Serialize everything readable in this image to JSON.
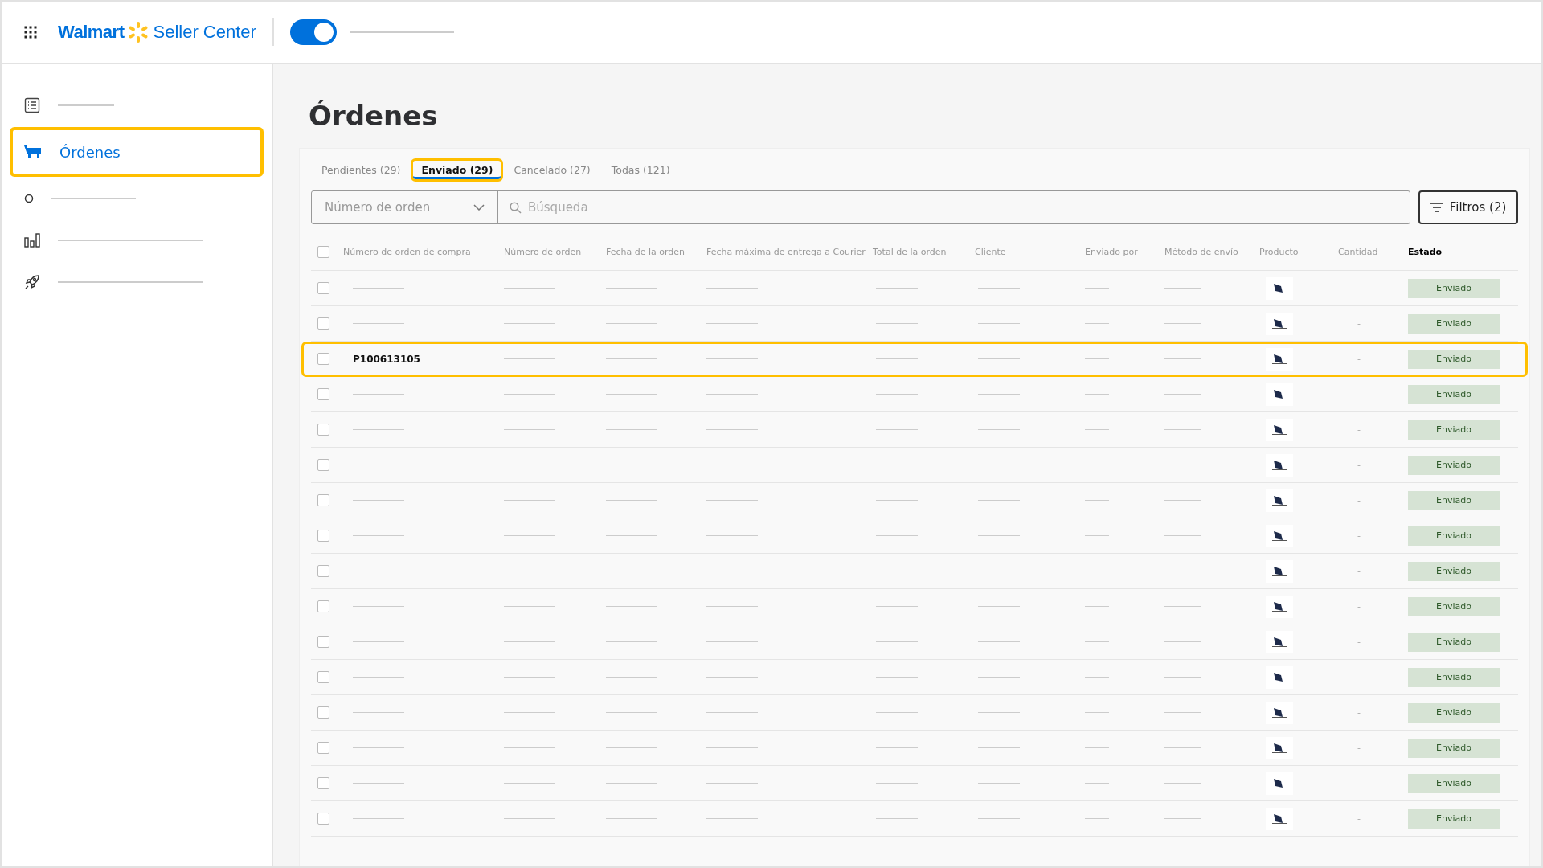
{
  "header": {
    "brand": "Walmart",
    "product": "Seller Center",
    "toggle": {
      "on": true
    }
  },
  "sidebar": {
    "items": [
      {
        "kind": "list",
        "selected": false,
        "highlighted": false
      },
      {
        "kind": "cart",
        "label": "Órdenes",
        "selected": true,
        "highlighted": true
      },
      {
        "kind": "circle",
        "selected": false,
        "highlighted": false
      },
      {
        "kind": "chart",
        "selected": false,
        "highlighted": false
      },
      {
        "kind": "rocket",
        "selected": false,
        "highlighted": false
      }
    ]
  },
  "page": {
    "title": "Órdenes"
  },
  "tabs": [
    {
      "label": "Pendientes (29)",
      "selected": false,
      "highlighted": false
    },
    {
      "label": "Enviado (29)",
      "selected": true,
      "highlighted": true
    },
    {
      "label": "Cancelado (27)",
      "selected": false,
      "highlighted": false
    },
    {
      "label": "Todas (121)",
      "selected": false,
      "highlighted": false
    }
  ],
  "filter_select": {
    "placeholder": "Número de orden"
  },
  "search": {
    "placeholder": "Búsqueda"
  },
  "filters_button": {
    "label": "Filtros (2)"
  },
  "table": {
    "columns": [
      "Número de orden de compra",
      "Número de orden",
      "Fecha de la orden",
      "Fecha máxima de entrega a Courier",
      "Total de la orden",
      "Cliente",
      "Enviado por",
      "Método de envío",
      "Producto",
      "Cantidad",
      "Estado"
    ],
    "select_all_checked": false,
    "rows": [
      {
        "checked": false,
        "highlighted": false,
        "quantity": "-",
        "status": "Enviado"
      },
      {
        "checked": false,
        "highlighted": false,
        "quantity": "-",
        "status": "Enviado"
      },
      {
        "checked": false,
        "highlighted": true,
        "order_number": "P100613105",
        "quantity": "-",
        "status": "Enviado"
      },
      {
        "checked": false,
        "highlighted": false,
        "quantity": "-",
        "status": "Enviado"
      },
      {
        "checked": false,
        "highlighted": false,
        "quantity": "-",
        "status": "Enviado"
      },
      {
        "checked": false,
        "highlighted": false,
        "quantity": "-",
        "status": "Enviado"
      },
      {
        "checked": false,
        "highlighted": false,
        "quantity": "-",
        "status": "Enviado"
      },
      {
        "checked": false,
        "highlighted": false,
        "quantity": "-",
        "status": "Enviado"
      },
      {
        "checked": false,
        "highlighted": false,
        "quantity": "-",
        "status": "Enviado"
      },
      {
        "checked": false,
        "highlighted": false,
        "quantity": "-",
        "status": "Enviado"
      },
      {
        "checked": false,
        "highlighted": false,
        "quantity": "-",
        "status": "Enviado"
      },
      {
        "checked": false,
        "highlighted": false,
        "quantity": "-",
        "status": "Enviado"
      },
      {
        "checked": false,
        "highlighted": false,
        "quantity": "-",
        "status": "Enviado"
      },
      {
        "checked": false,
        "highlighted": false,
        "quantity": "-",
        "status": "Enviado"
      },
      {
        "checked": false,
        "highlighted": false,
        "quantity": "-",
        "status": "Enviado"
      },
      {
        "checked": false,
        "highlighted": false,
        "quantity": "-",
        "status": "Enviado"
      }
    ]
  }
}
